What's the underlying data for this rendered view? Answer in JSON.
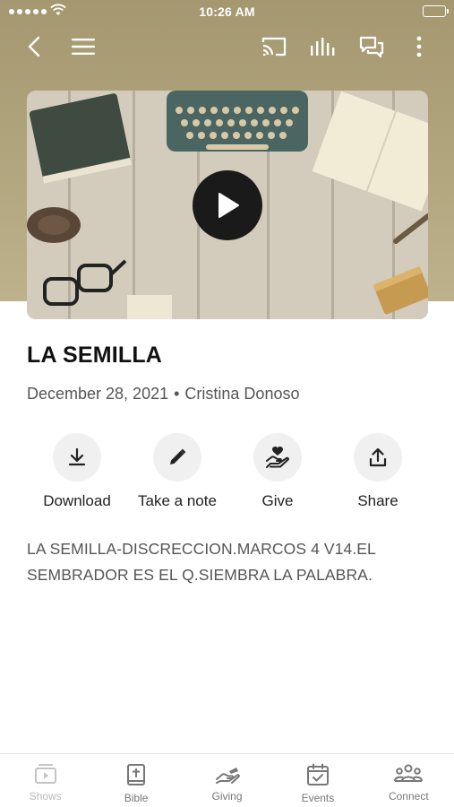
{
  "status_bar": {
    "time": "10:26 AM"
  },
  "nav": {
    "back_icon": "chevron-left-icon",
    "menu_icon": "hamburger-icon",
    "cast_icon": "cast-icon",
    "audio_icon": "audio-bars-icon",
    "chat_icon": "chat-icon",
    "more_icon": "more-vertical-icon"
  },
  "video": {
    "play_icon": "play-icon"
  },
  "sermon": {
    "title": "LA SEMILLA",
    "date": "December 28, 2021",
    "separator": "•",
    "speaker": "Cristina Donoso",
    "description": "LA SEMILLA-DISCRECCION.MARCOS 4 V14.EL SEMBRADOR ES EL Q.SIEMBRA LA PALABRA."
  },
  "actions": [
    {
      "label": "Download",
      "icon": "download-icon"
    },
    {
      "label": "Take a note",
      "icon": "pencil-icon"
    },
    {
      "label": "Give",
      "icon": "give-heart-hand-icon"
    },
    {
      "label": "Share",
      "icon": "share-icon"
    }
  ],
  "tabs": [
    {
      "label": "Shows",
      "icon": "shows-icon"
    },
    {
      "label": "Bible",
      "icon": "bible-icon"
    },
    {
      "label": "Giving",
      "icon": "giving-icon"
    },
    {
      "label": "Events",
      "icon": "events-icon"
    },
    {
      "label": "Connect",
      "icon": "connect-icon"
    }
  ],
  "colors": {
    "header_bg": "#a59870",
    "tab_inactive": "#777777",
    "tab_dim": "#bbbbbb"
  }
}
